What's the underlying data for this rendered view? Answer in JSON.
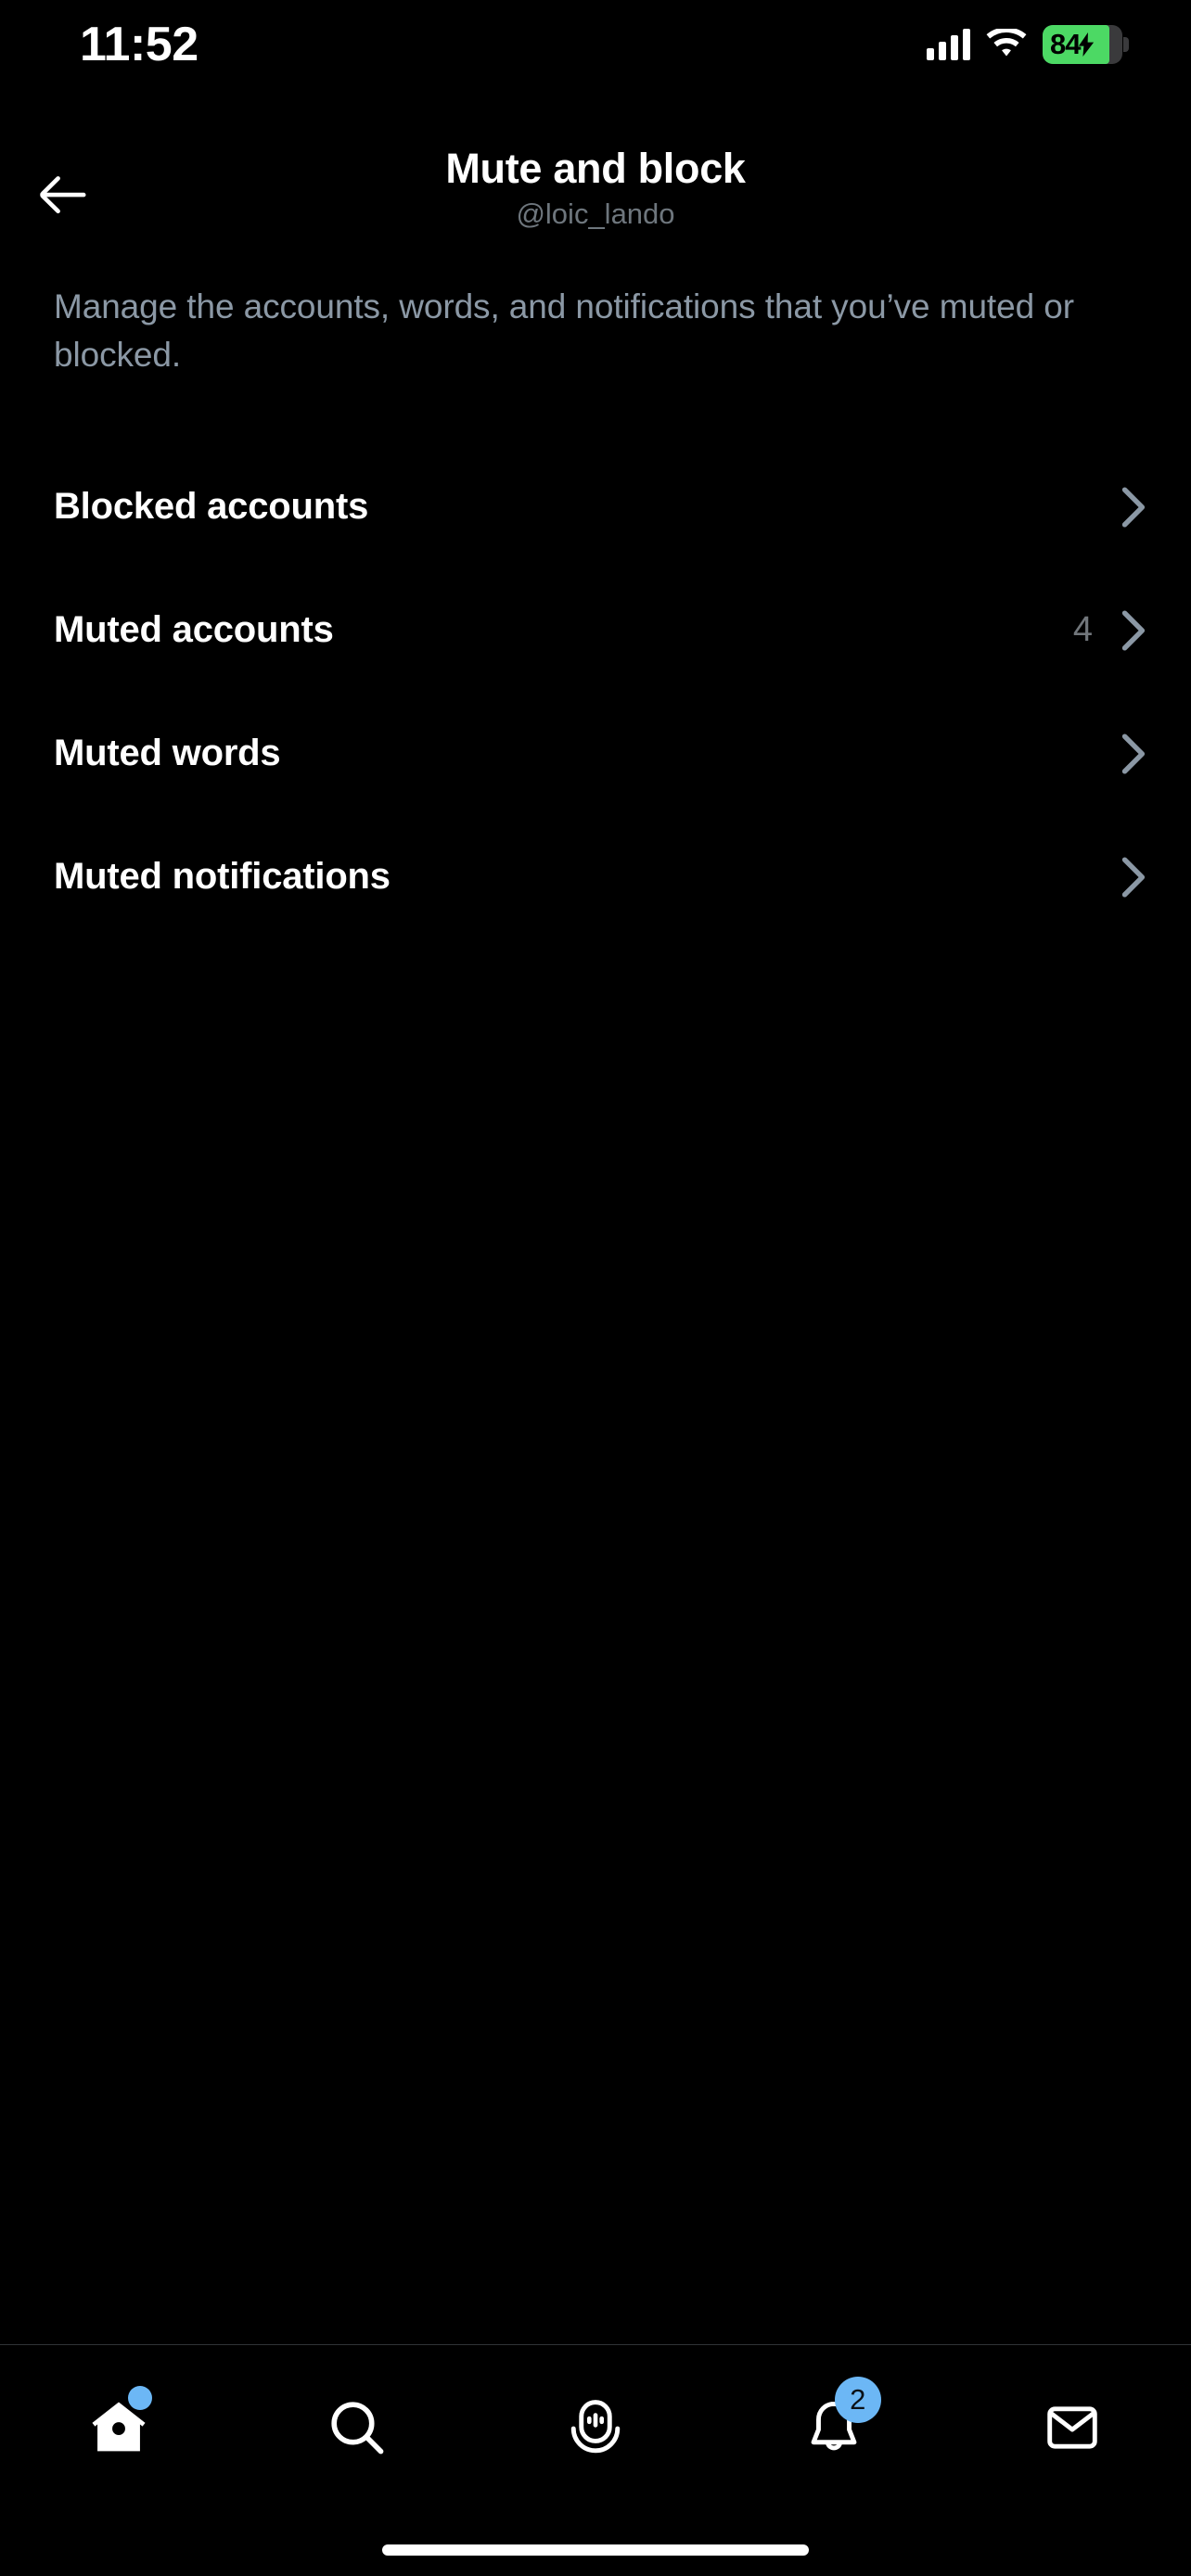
{
  "status_bar": {
    "time": "11:52",
    "cellular_icon": "cellular-signal-icon",
    "wifi_icon": "wifi-icon",
    "battery_percent": "84",
    "battery_charging": true,
    "battery_color": "#4CD964"
  },
  "nav": {
    "back_icon": "back-arrow-icon",
    "title": "Mute and block",
    "subtitle": "@loic_lando"
  },
  "description": "Manage the accounts, words, and notifications that you’ve muted or blocked.",
  "list": {
    "items": [
      {
        "label": "Blocked accounts",
        "count": "",
        "chevron": "chevron-right-icon"
      },
      {
        "label": "Muted accounts",
        "count": "4",
        "chevron": "chevron-right-icon"
      },
      {
        "label": "Muted words",
        "count": "",
        "chevron": "chevron-right-icon"
      },
      {
        "label": "Muted notifications",
        "count": "",
        "chevron": "chevron-right-icon"
      }
    ]
  },
  "tabbar": {
    "items": [
      {
        "name": "home",
        "icon": "home-icon",
        "badge": "",
        "badge_type": "dot",
        "active": true
      },
      {
        "name": "search",
        "icon": "search-icon",
        "badge": "",
        "badge_type": "none",
        "active": false
      },
      {
        "name": "spaces",
        "icon": "spaces-microphone-icon",
        "badge": "",
        "badge_type": "none",
        "active": false
      },
      {
        "name": "notifications",
        "icon": "bell-icon",
        "badge": "2",
        "badge_type": "number",
        "active": false
      },
      {
        "name": "messages",
        "icon": "envelope-icon",
        "badge": "",
        "badge_type": "none",
        "active": false
      }
    ],
    "badge_color": "#6CB7F5"
  },
  "colors": {
    "background": "#000000",
    "primary_text": "#FFFFFF",
    "secondary_text": "#71767B",
    "divider": "#2F3336",
    "accent": "#1D9BF0"
  }
}
